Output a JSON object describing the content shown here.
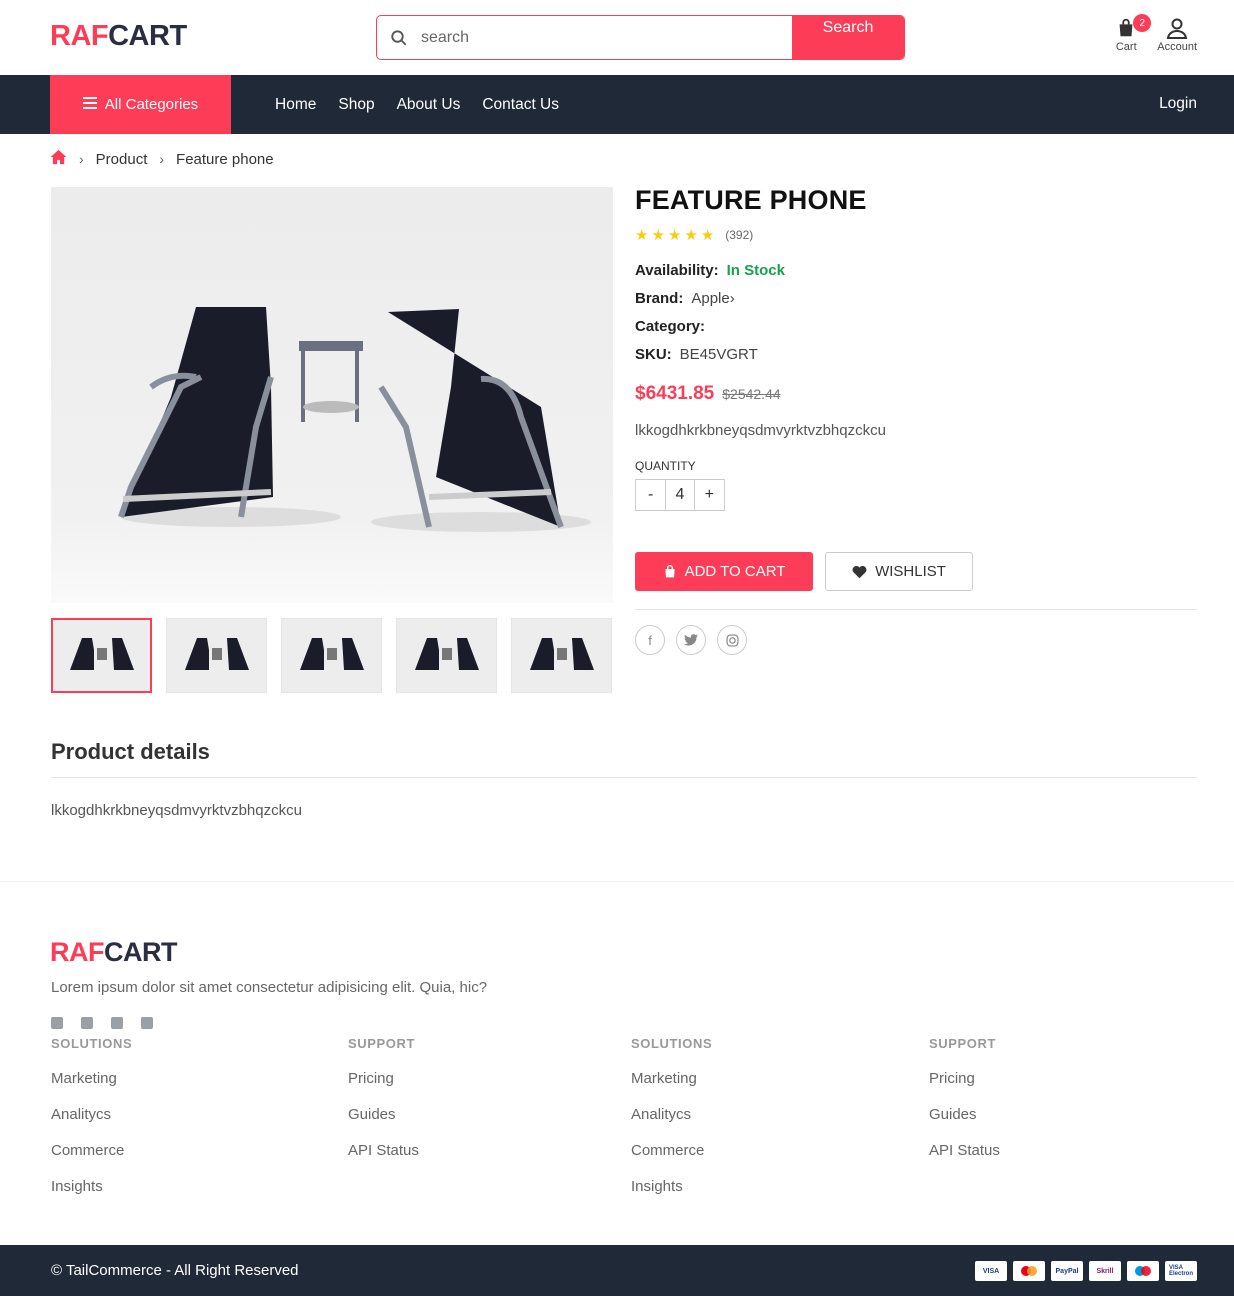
{
  "brand": {
    "part1": "RAF",
    "part2": "CART",
    "accent_color": "#fd3d57",
    "dark_color": "#1f2937"
  },
  "search": {
    "placeholder": "search",
    "button_label": "Search"
  },
  "header_icons": {
    "cart_label": "Cart",
    "cart_count": "2",
    "account_label": "Account"
  },
  "nav": {
    "all_categories": "All Categories",
    "links": [
      "Home",
      "Shop",
      "About Us",
      "Contact Us"
    ],
    "login": "Login"
  },
  "breadcrumb": {
    "items": [
      "Product",
      "Feature phone"
    ]
  },
  "product": {
    "title": "FEATURE PHONE",
    "rating_stars": 5,
    "rating_count": "(392)",
    "availability_label": "Availability:",
    "availability_value": "In Stock",
    "brand_label": "Brand:",
    "brand_value": "Apple›",
    "category_label": "Category:",
    "category_value": "",
    "sku_label": "SKU:",
    "sku_value": "BE45VGRT",
    "price": "$6431.85",
    "old_price": "$2542.44",
    "short_desc": "lkkogdhkrkbneyqsdmvyrktvzbhqzckcu",
    "quantity_label": "QUANTITY",
    "quantity_value": "4",
    "add_to_cart": "ADD TO CART",
    "wishlist": "WISHLIST"
  },
  "details": {
    "title": "Product details",
    "text": "lkkogdhkrkbneyqsdmvyrktvzbhqzckcu"
  },
  "footer": {
    "description": "Lorem ipsum dolor sit amet consectetur adipisicing elit. Quia, hic?",
    "columns": [
      {
        "title": "SOLUTIONS",
        "items": [
          "Marketing",
          "Analitycs",
          "Commerce",
          "Insights"
        ]
      },
      {
        "title": "SUPPORT",
        "items": [
          "Pricing",
          "Guides",
          "API Status"
        ]
      },
      {
        "title": "SOLUTIONS",
        "items": [
          "Marketing",
          "Analitycs",
          "Commerce",
          "Insights"
        ]
      },
      {
        "title": "SUPPORT",
        "items": [
          "Pricing",
          "Guides",
          "API Status"
        ]
      }
    ],
    "copyright": "© TailCommerce - All Right Reserved",
    "payment_methods": [
      "VISA",
      "Mastercard",
      "PayPal",
      "Skrill",
      "Maestro",
      "VISA Electron"
    ]
  }
}
